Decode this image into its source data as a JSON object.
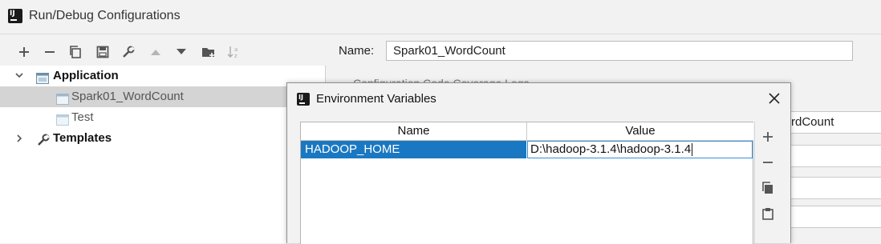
{
  "window": {
    "title": "Run/Debug Configurations"
  },
  "toolbar": {
    "items": [
      "add-icon",
      "remove-icon",
      "copy-icon",
      "save-icon",
      "wrench-icon",
      "move-up-icon",
      "move-down-icon",
      "folder-icon",
      "sort-icon"
    ]
  },
  "tree": {
    "application": "Application",
    "app_items": [
      "Spark01_WordCount",
      "Test"
    ],
    "templates": "Templates"
  },
  "config": {
    "name_label": "Name:",
    "name_value": "Spark01_WordCount",
    "partial_label": "Configuration        Code Coverage        Logs",
    "main_class_tail": "rdCount"
  },
  "dialog": {
    "title": "Environment Variables",
    "columns": [
      "Name",
      "Value"
    ],
    "rows": [
      {
        "name": "HADOOP_HOME",
        "value": "D:\\hadoop-3.1.4\\hadoop-3.1.4"
      }
    ],
    "side_tools": [
      "add-icon",
      "remove-icon",
      "copy-icon",
      "paste-icon"
    ]
  },
  "colors": {
    "selection": "#1a78c2",
    "tree_selected": "#d4d4d4",
    "window_bg": "#f2f2f2"
  }
}
